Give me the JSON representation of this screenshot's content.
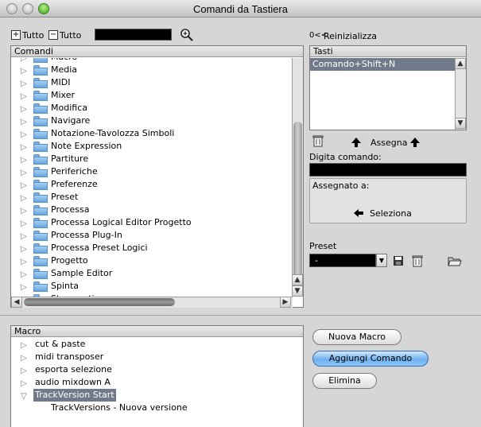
{
  "window": {
    "title": "Comandi da Tastiera"
  },
  "toolbar": {
    "expand_all_label": "Tutto",
    "collapse_all_label": "Tutto",
    "search_value": "",
    "reset_label": "Reinizializza",
    "reset_icon": "0<<"
  },
  "commands": {
    "header": "Comandi",
    "partial_top": "Macro",
    "partial_bottom": "Strumenti",
    "items": [
      "Media",
      "MIDI",
      "Mixer",
      "Modifica",
      "Navigare",
      "Notazione-Tavolozza Simboli",
      "Note Expression",
      "Partiture",
      "Periferiche",
      "Preferenze",
      "Preset",
      "Processa",
      "Processa Logical Editor Progetto",
      "Processa Plug-In",
      "Processa Preset Logici",
      "Progetto",
      "Sample Editor",
      "Spinta"
    ]
  },
  "keys": {
    "header": "Tasti",
    "items": [
      "Comando+Shift+N"
    ],
    "assign_label": "Assegna",
    "type_command_label": "Digita comando:",
    "type_command_value": "",
    "assigned_to_label": "Assegnato a:",
    "select_label": "Seleziona"
  },
  "preset": {
    "label": "Preset",
    "value": "-"
  },
  "macro": {
    "header": "Macro",
    "items": [
      {
        "label": "cut & paste",
        "selected": false
      },
      {
        "label": "midi transposer",
        "selected": false
      },
      {
        "label": "esporta selezione",
        "selected": false
      },
      {
        "label": "audio mixdown A",
        "selected": false
      },
      {
        "label": "TrackVersion Start",
        "selected": true
      }
    ],
    "child": "TrackVersions - Nuova versione",
    "new_macro_label": "Nuova Macro",
    "add_command_label": "Aggiungi Comando",
    "delete_label": "Elimina"
  },
  "colors": {
    "selection": "#707a8a",
    "default_button": "#6fb1f0"
  }
}
